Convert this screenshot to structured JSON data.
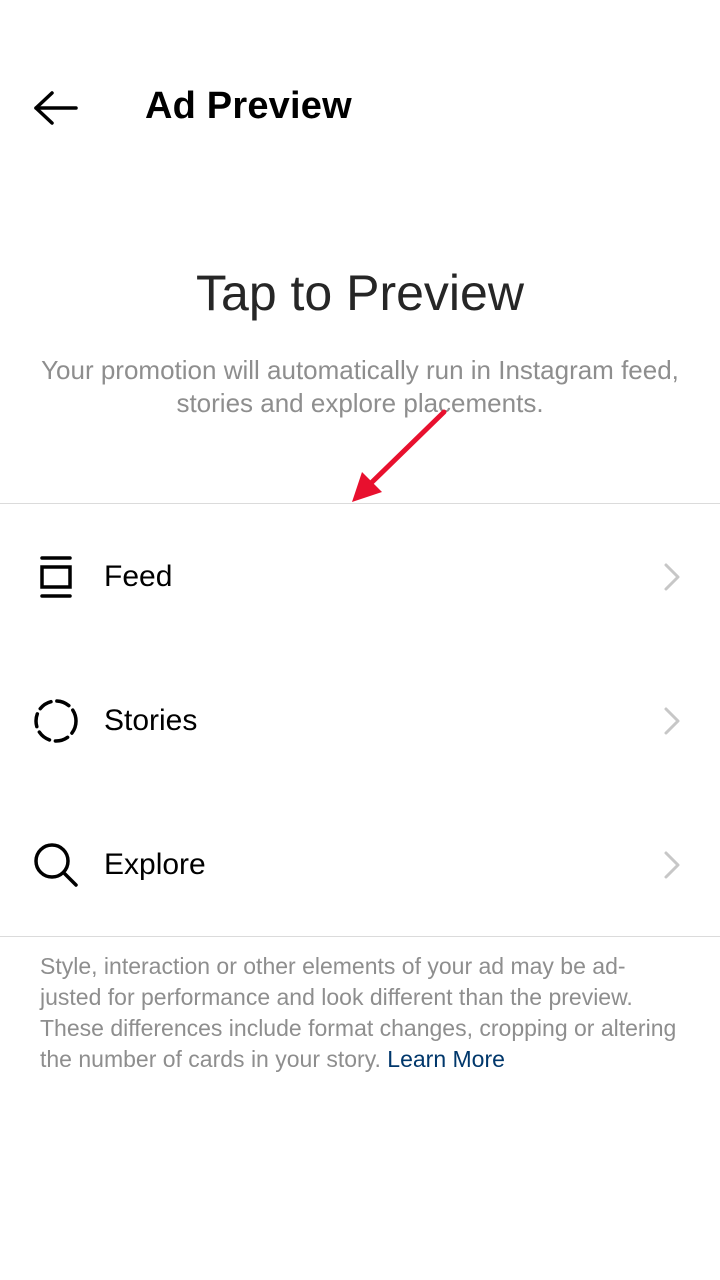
{
  "header": {
    "back_icon": "arrow-left-icon",
    "title": "Ad Preview"
  },
  "intro": {
    "title": "Tap to Preview",
    "description": "Your promotion will automatically run in Instagram feed, stories and explore placements."
  },
  "placements": [
    {
      "label": "Feed",
      "icon": "feed-icon"
    },
    {
      "label": "Stories",
      "icon": "stories-icon"
    },
    {
      "label": "Explore",
      "icon": "search-icon"
    }
  ],
  "note": {
    "text": "Style, interaction or other elements of your ad may be ad-justed for performance and look different than the preview. These differences include format changes, cropping or altering the number of cards in your story.",
    "link_label": "Learn More"
  },
  "colors": {
    "link": "#00376b",
    "muted_text": "#8e8e8e",
    "divider": "#dbdbdb",
    "annotation_arrow": "#e8102e"
  }
}
